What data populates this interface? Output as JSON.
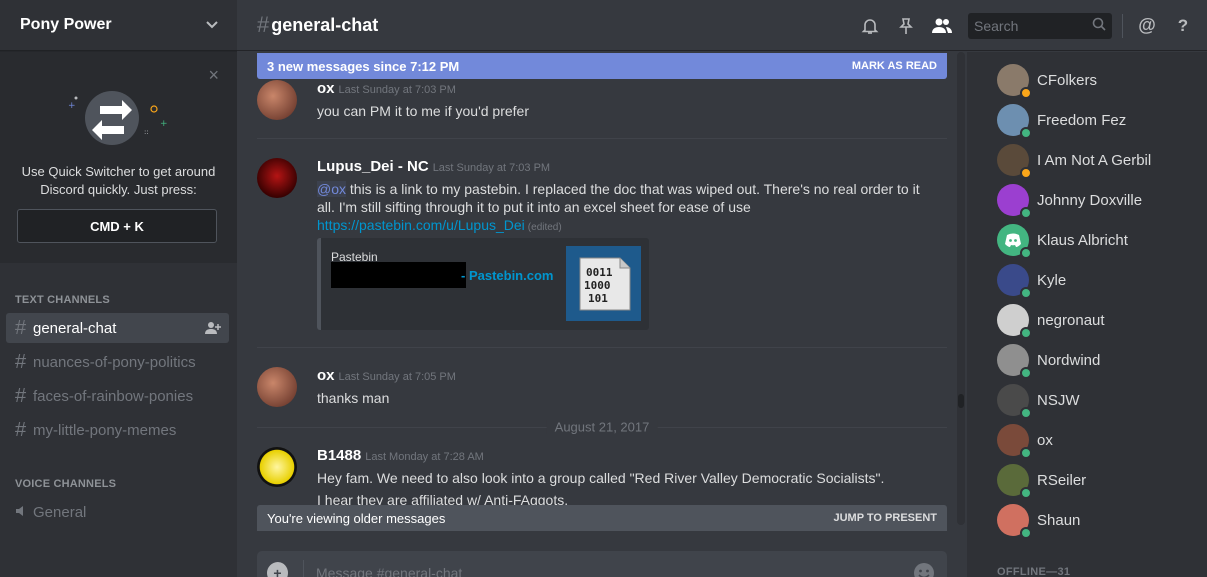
{
  "guild": {
    "name": "Pony Power"
  },
  "quick_switcher": {
    "text": "Use Quick Switcher to get around Discord quickly. Just press:",
    "shortcut": "CMD + K",
    "close": "×"
  },
  "categories": {
    "text": "TEXT CHANNELS",
    "voice": "VOICE CHANNELS"
  },
  "text_channels": [
    {
      "label": "general-chat",
      "active": true
    },
    {
      "label": "nuances-of-pony-politics"
    },
    {
      "label": "faces-of-rainbow-ponies"
    },
    {
      "label": "my-little-pony-memes"
    }
  ],
  "voice_channels": [
    {
      "label": "General"
    }
  ],
  "header": {
    "channel": "general-chat",
    "search_placeholder": "Search"
  },
  "banners": {
    "new_messages": "3 new messages since 7:12 PM",
    "mark_as_read": "MARK AS READ",
    "older": "You're viewing older messages",
    "jump": "JUMP TO PRESENT"
  },
  "messages": [
    {
      "author": "ox",
      "time": "Last Sunday at 7:03 PM",
      "text": "you can PM it to me if you'd prefer"
    },
    {
      "author": "Lupus_Dei - NC",
      "time": "Last Sunday at 7:03 PM",
      "mention": "@ox",
      "text": " this is a link to my pastebin. I replaced the doc that was wiped out. There's no real order to it all. I'm still sifting through it to put it into an excel sheet for ease of use",
      "link": "https://pastebin.com/u/Lupus_Dei",
      "edited": "(edited)",
      "embed": {
        "provider": "Pastebin",
        "title": "- Pastebin.com",
        "thumb_text": "0011\n1000\n101"
      }
    },
    {
      "author": "ox",
      "time": "Last Sunday at 7:05 PM",
      "text": "thanks man"
    },
    {
      "author": "B1488",
      "time": "Last Monday at 7:28 AM",
      "text": "Hey fam. We need to also look into a group called \"Red River Valley Democratic Socialists\".",
      "text2": "I hear they are affiliated w/ Anti-FAggots."
    }
  ],
  "date_separator": "August 21, 2017",
  "composer": {
    "placeholder": "Message #general-chat"
  },
  "members": [
    {
      "name": "CFolkers",
      "status": "#faa61a",
      "color": "#8a7a6a"
    },
    {
      "name": "Freedom Fez",
      "status": "#43b581",
      "color": "#6d8fb0"
    },
    {
      "name": "I Am Not A Gerbil",
      "status": "#faa61a",
      "color": "#5a4a3a"
    },
    {
      "name": "Johnny Doxville",
      "status": "#43b581",
      "color": "#9b3fd0"
    },
    {
      "name": "Klaus Albricht",
      "status": "#43b581",
      "color": "#43b581"
    },
    {
      "name": "Kyle",
      "status": "#43b581",
      "color": "#3a4a8a"
    },
    {
      "name": "negronaut",
      "status": "#43b581",
      "color": "#cfcfcf"
    },
    {
      "name": "Nordwind",
      "status": "#43b581",
      "color": "#8f8f8f"
    },
    {
      "name": "NSJW",
      "status": "#43b581",
      "color": "#4a4a4a"
    },
    {
      "name": "ox",
      "status": "#43b581",
      "color": "#7a4a3a"
    },
    {
      "name": "RSeiler",
      "status": "#43b581",
      "color": "#5a6a3a"
    },
    {
      "name": "Shaun",
      "status": "#43b581",
      "color": "#d07060"
    }
  ],
  "offline_label": "OFFLINE—31"
}
